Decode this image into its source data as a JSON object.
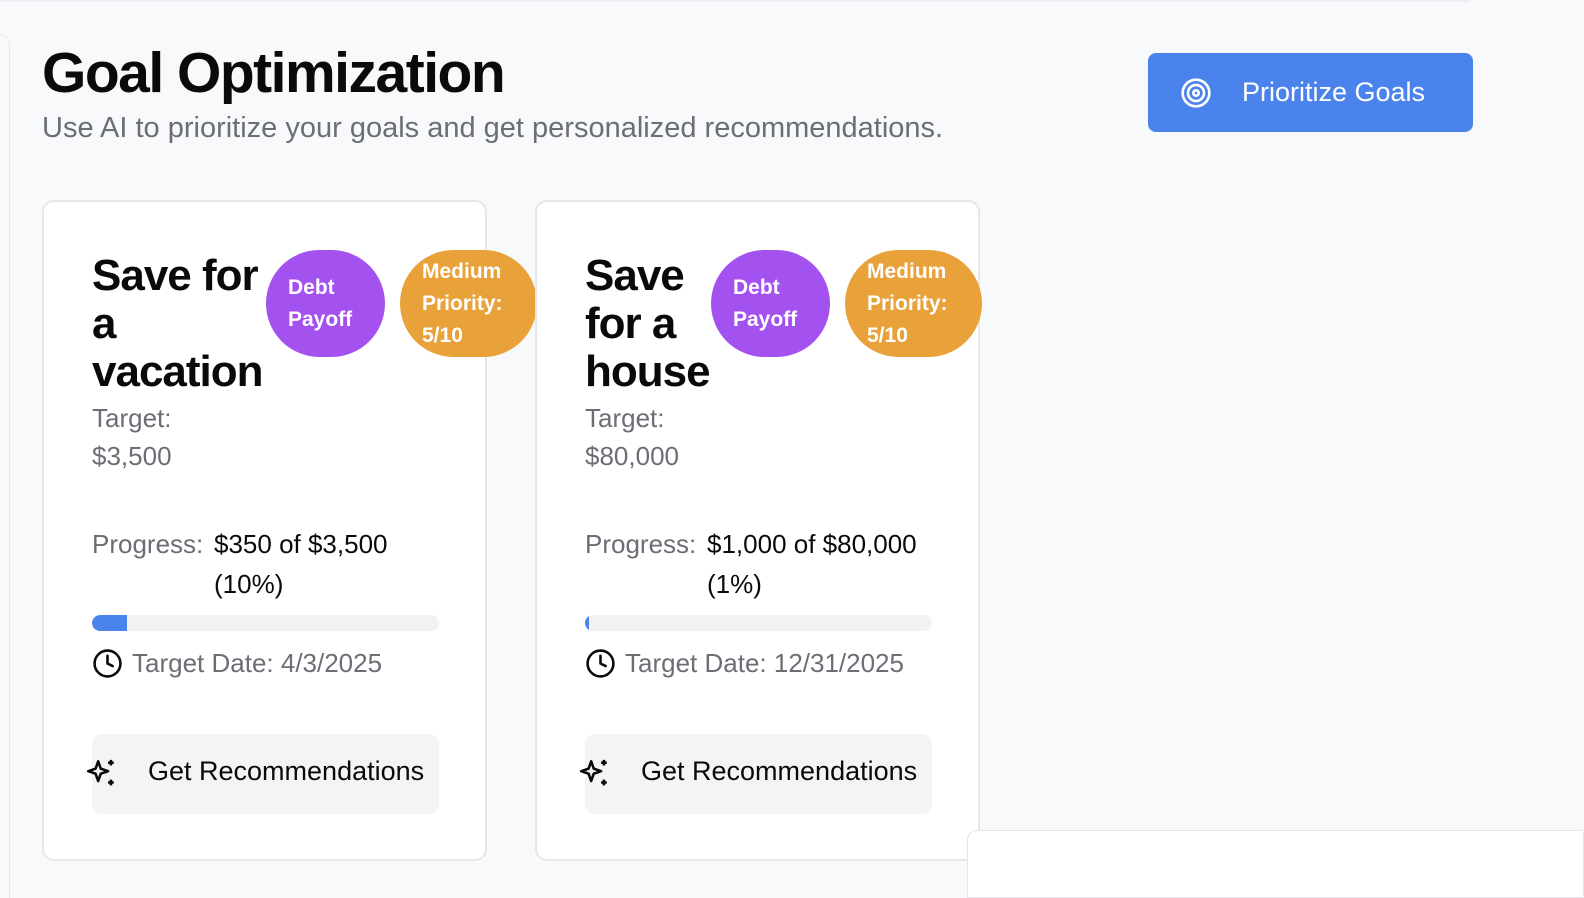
{
  "header": {
    "title": "Goal Optimization",
    "subtitle": "Use AI to prioritize your goals and get personalized recommendations.",
    "prioritize_label": "Prioritize Goals"
  },
  "goals": [
    {
      "title": "Save for a vacation",
      "type": "Debt Payoff",
      "priority": "Medium Priority: 5/10",
      "target_label": "Target:",
      "target_value": "$3,500",
      "progress_label": "Progress:",
      "progress_value": "$350 of $3,500 (10%)",
      "progress_fraction": 0.1,
      "date": "Target Date: 4/3/2025",
      "rec_label": "Get Recommendations"
    },
    {
      "title": "Save for a house",
      "type": "Debt Payoff",
      "priority": "Medium Priority: 5/10",
      "target_label": "Target:",
      "target_value": "$80,000",
      "progress_label": "Progress:",
      "progress_value": "$1,000 of $80,000 (1%)",
      "progress_fraction": 0.0125,
      "date": "Target Date: 12/31/2025",
      "rec_label": "Get Recommendations"
    }
  ],
  "colors": {
    "accent": "#4b83ec",
    "type_badge": "#a452ef",
    "priority_badge": "#e9a23a"
  },
  "icons": {
    "prioritize": "target-icon",
    "date": "clock-icon",
    "recommend": "sparkles-icon"
  }
}
